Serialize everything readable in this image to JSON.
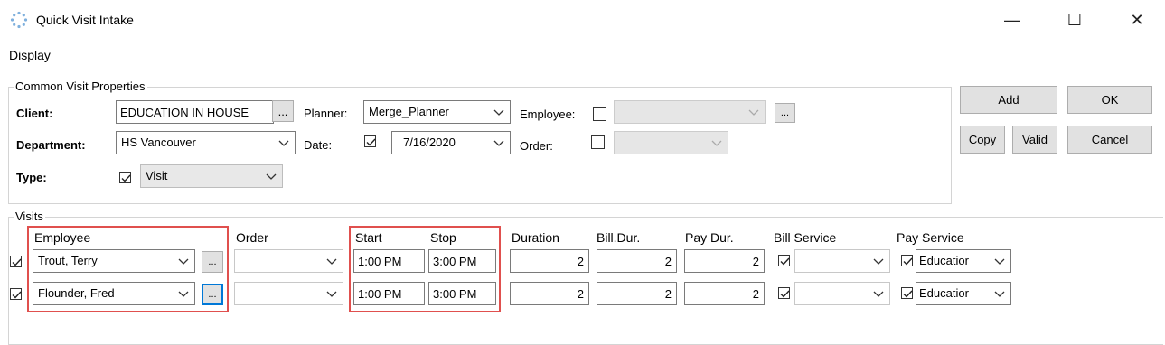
{
  "window": {
    "title": "Quick Visit Intake",
    "controls": {
      "minimize": "—",
      "maximize": "☐",
      "close": "✕"
    }
  },
  "menu": {
    "items": [
      "Display"
    ]
  },
  "common": {
    "group_title": "Common Visit Properties",
    "client_label": "Client:",
    "client_value": "EDUCATION IN HOUSE",
    "department_label": "Department:",
    "department_value": "HS Vancouver",
    "type_label": "Type:",
    "type_value": "Visit",
    "planner_label": "Planner:",
    "planner_value": "Merge_Planner",
    "date_label": "Date:",
    "date_value": "7/16/2020",
    "employee_label": "Employee:",
    "order_label": "Order:",
    "ellipsis": "..."
  },
  "actions": {
    "add": "Add",
    "ok": "OK",
    "copy": "Copy",
    "valid": "Valid",
    "cancel": "Cancel"
  },
  "visits": {
    "group_title": "Visits",
    "headers": {
      "employee": "Employee",
      "order": "Order",
      "start": "Start",
      "stop": "Stop",
      "duration": "Duration",
      "bill_dur": "Bill.Dur.",
      "pay_dur": "Pay Dur.",
      "bill_service": "Bill Service",
      "pay_service": "Pay Service"
    },
    "rows": [
      {
        "employee": "Trout, Terry",
        "start": "1:00 PM",
        "stop": "3:00 PM",
        "duration": "2",
        "bill_dur": "2",
        "pay_dur": "2",
        "pay_service": "Educatior"
      },
      {
        "employee": "Flounder, Fred",
        "start": "1:00 PM",
        "stop": "3:00 PM",
        "duration": "2",
        "bill_dur": "2",
        "pay_dur": "2",
        "pay_service": "Educatior"
      }
    ]
  }
}
